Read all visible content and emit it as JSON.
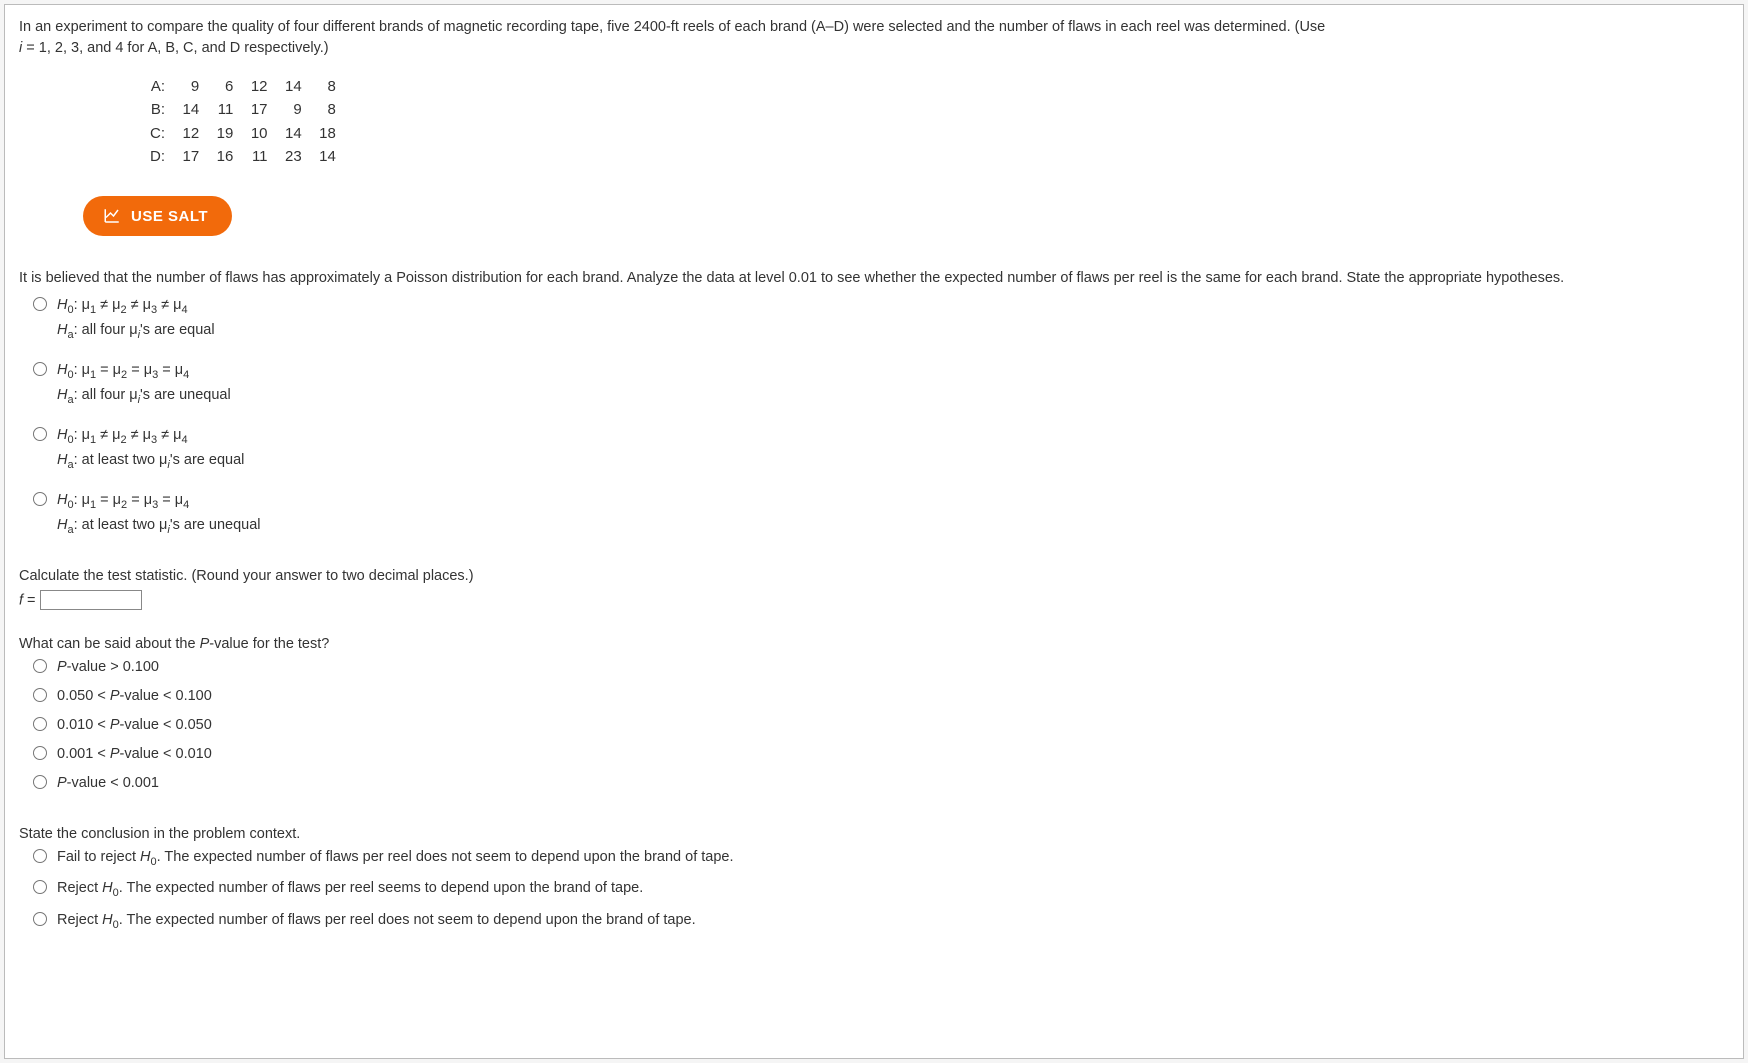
{
  "intro": {
    "l1_a": "In an experiment to compare the quality of four different brands of magnetic recording tape, five 2400-ft reels of each brand (A–D) were selected and the number of flaws in each reel was determined. (Use",
    "l2_a": "i",
    "l2_b": " = 1, 2, 3, and 4 for A, B, C, and D respectively.)"
  },
  "data": {
    "labels": [
      "A:",
      "B:",
      "C:",
      "D:"
    ],
    "rows": [
      [
        "9",
        "6",
        "12",
        "14",
        "8"
      ],
      [
        "14",
        "11",
        "17",
        "9",
        "8"
      ],
      [
        "12",
        "19",
        "10",
        "14",
        "18"
      ],
      [
        "17",
        "16",
        "11",
        "23",
        "14"
      ]
    ]
  },
  "salt_label": "USE SALT",
  "belief": "It is believed that the number of flaws has approximately a Poisson distribution for each brand. Analyze the data at level 0.01 to see whether the expected number of flaws per reel is the same for each brand. State the appropriate hypotheses.",
  "hypo": {
    "o1": {
      "l1_pre": "H",
      "l1_sub": "0",
      "l1_mid": ": μ",
      "l1_s1": "1",
      "ne": " ≠ μ",
      "s2": "2",
      "s3": "3",
      "s4": "4",
      "l2_pre": "H",
      "l2_sub": "a",
      "l2_txt": ": all four μ",
      "l2_i": "i",
      "l2_end": "'s are equal"
    },
    "o2": {
      "l1_pre": "H",
      "l1_sub": "0",
      "l1_mid": ": μ",
      "s1": "1",
      "eq": " = μ",
      "s2": "2",
      "s3": "3",
      "s4": "4",
      "l2_pre": "H",
      "l2_sub": "a",
      "l2_txt": ": all four μ",
      "l2_i": "i",
      "l2_end": "'s are unequal"
    },
    "o3": {
      "l1_pre": "H",
      "l1_sub": "0",
      "l1_mid": ": μ",
      "s1": "1",
      "ne": " ≠ μ",
      "s2": "2",
      "s3": "3",
      "s4": "4",
      "l2_pre": "H",
      "l2_sub": "a",
      "l2_txt": ": at least two μ",
      "l2_i": "i",
      "l2_end": "'s are equal"
    },
    "o4": {
      "l1_pre": "H",
      "l1_sub": "0",
      "l1_mid": ": μ",
      "s1": "1",
      "eq": " = μ",
      "s2": "2",
      "s3": "3",
      "s4": "4",
      "l2_pre": "H",
      "l2_sub": "a",
      "l2_txt": ": at least two μ",
      "l2_i": "i",
      "l2_end": "'s are unequal"
    }
  },
  "teststat": {
    "prompt": "Calculate the test statistic. (Round your answer to two decimal places.)",
    "flabel": "f",
    "equals": " = "
  },
  "pvalue": {
    "prompt_a": "What can be said about the ",
    "prompt_i": "P",
    "prompt_b": "-value for the test?",
    "opts": [
      {
        "i": "P",
        "rest": "-value > 0.100"
      },
      {
        "pre": "0.050 < ",
        "i": "P",
        "rest": "-value < 0.100"
      },
      {
        "pre": "0.010 < ",
        "i": "P",
        "rest": "-value < 0.050"
      },
      {
        "pre": "0.001 < ",
        "i": "P",
        "rest": "-value < 0.010"
      },
      {
        "i": "P",
        "rest": "-value < 0.001"
      }
    ]
  },
  "conclusion": {
    "prompt": "State the conclusion in the problem context.",
    "o1_a": "Fail to reject ",
    "o1_Hi": "H",
    "o1_sub": "0",
    "o1_b": ". The expected number of flaws per reel does not seem to depend upon the brand of tape.",
    "o2_a": "Reject ",
    "o2_Hi": "H",
    "o2_sub": "0",
    "o2_b": ". The expected number of flaws per reel seems to depend upon the brand of tape.",
    "o3_a": "Reject ",
    "o3_Hi": "H",
    "o3_sub": "0",
    "o3_b": ". The expected number of flaws per reel does not seem to depend upon the brand of tape."
  }
}
